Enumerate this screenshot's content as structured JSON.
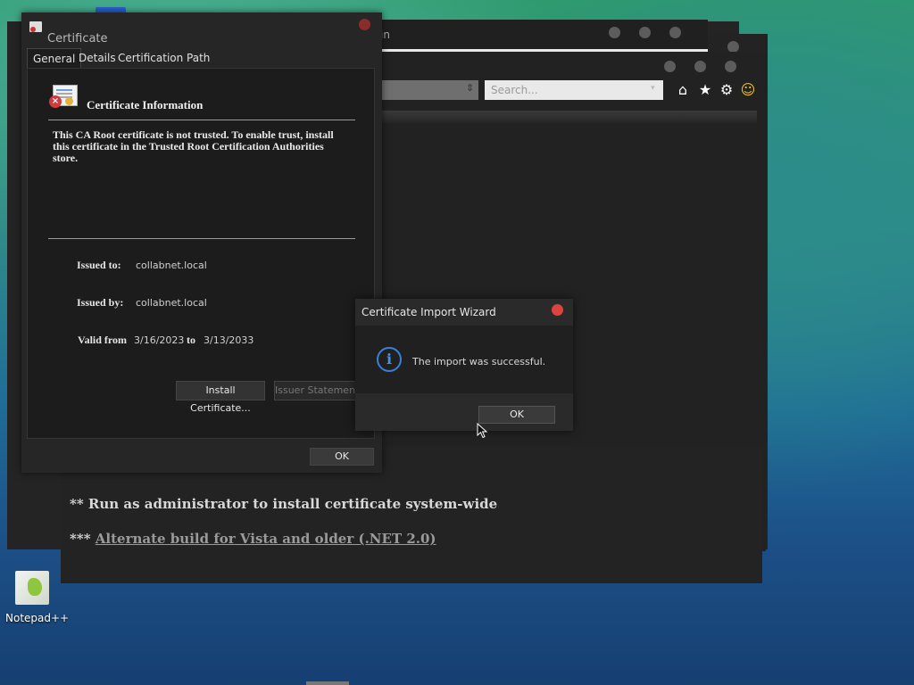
{
  "browser": {
    "title_fragment": "in",
    "search_placeholder": "Search..."
  },
  "page": {
    "line1": "** Run as administrator to install certificate system-wide",
    "line2_prefix": "***",
    "line2_link": "Alternate build for Vista and older (.NET 2.0)"
  },
  "desktop": {
    "notepad_label": "Notepad++"
  },
  "certificate": {
    "title": "Certificate",
    "tabs": [
      "General",
      "Details",
      "Certification Path"
    ],
    "heading": "Certificate Information",
    "message": "This CA Root certificate is not trusted. To enable trust, install this certificate in the Trusted Root Certification Authorities store.",
    "issued_to_label": "Issued to:",
    "issued_to": "collabnet.local",
    "issued_by_label": "Issued by:",
    "issued_by": "collabnet.local",
    "valid_from_label": "Valid from",
    "valid_from": "3/16/2023",
    "to_label": "to",
    "valid_to": "3/13/2033",
    "install_button": "Install Certificate...",
    "issuer_button": "Issuer Statement",
    "ok_button": "OK"
  },
  "wizard": {
    "title": "Certificate Import Wizard",
    "message": "The import was successful.",
    "ok_button": "OK"
  },
  "colors": {
    "close_red": "#d9443f",
    "info_blue": "#3c7fd8"
  }
}
